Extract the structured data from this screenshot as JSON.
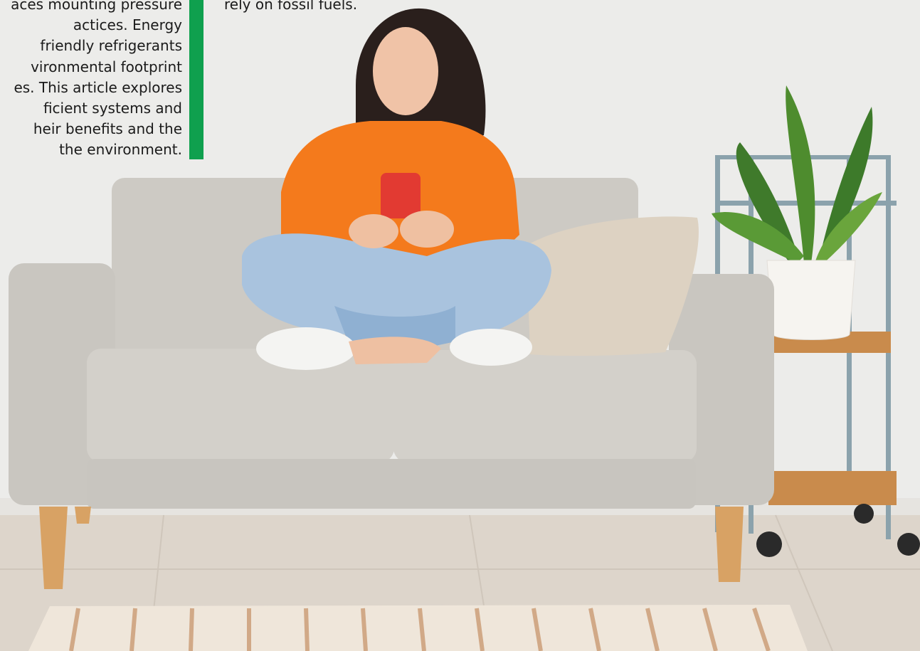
{
  "article": {
    "lines": [
      "aces mounting pressure",
      "actices. Energy",
      "friendly refrigerants",
      "vironmental footprint",
      "es. This article explores",
      "ficient systems and",
      "heir benefits and the",
      "the environment."
    ],
    "continuation": "rely on fossil fuels."
  },
  "colors": {
    "accent_bar": "#0fa04e",
    "wall": "#ececea",
    "floor": "#dcd4ca",
    "sofa": "#cfccc6",
    "sweater": "#f47a1c",
    "jeans": "#a9c3de",
    "phone": "#e23a32"
  }
}
